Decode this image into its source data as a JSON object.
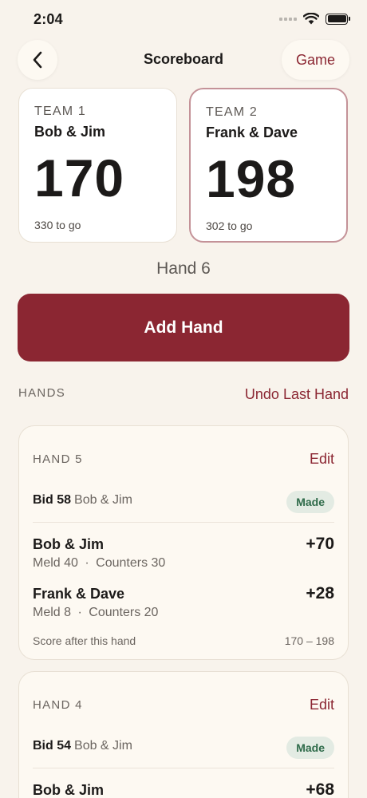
{
  "status": {
    "time": "2:04"
  },
  "nav": {
    "title": "Scoreboard",
    "game_label": "Game"
  },
  "teams": [
    {
      "label": "TEAM 1",
      "name": "Bob & Jim",
      "score": "170",
      "to_go": "330 to go"
    },
    {
      "label": "TEAM 2",
      "name": "Frank & Dave",
      "score": "198",
      "to_go": "302 to go"
    }
  ],
  "current_hand": "Hand 6",
  "add_hand_label": "Add Hand",
  "hands_section": {
    "title": "HANDS",
    "undo_label": "Undo Last Hand"
  },
  "hands": [
    {
      "title": "HAND 5",
      "edit_label": "Edit",
      "bid": "Bid 58",
      "bid_team": "Bob & Jim",
      "result": "Made",
      "rows": [
        {
          "team": "Bob & Jim",
          "meld": "Meld 40",
          "sep": "·",
          "counters": "Counters 30",
          "points": "+70"
        },
        {
          "team": "Frank & Dave",
          "meld": "Meld 8",
          "sep": "·",
          "counters": "Counters 20",
          "points": "+28"
        }
      ],
      "after_label": "Score after this hand",
      "after_score": "170 – 198"
    },
    {
      "title": "HAND 4",
      "edit_label": "Edit",
      "bid": "Bid 54",
      "bid_team": "Bob & Jim",
      "result": "Made",
      "rows": [
        {
          "team": "Bob & Jim",
          "points": "+68"
        }
      ]
    }
  ],
  "colors": {
    "accent": "#8b2632",
    "background": "#f8f3ec",
    "made_badge_bg": "#e3ebe3",
    "made_badge_text": "#2f6b4a",
    "leader_border": "#c49298"
  }
}
